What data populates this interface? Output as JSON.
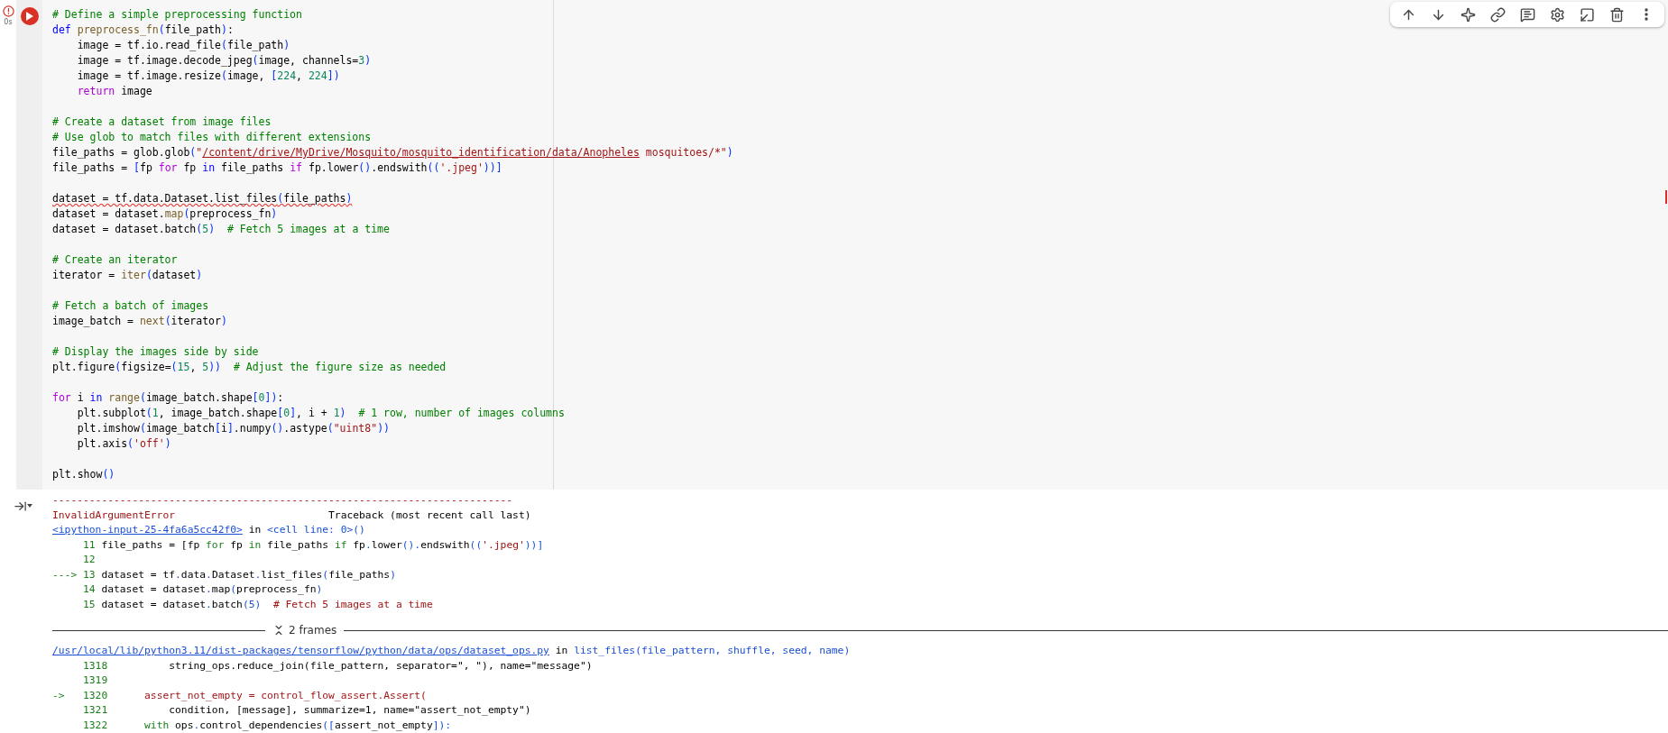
{
  "cell": {
    "error": true,
    "exec_time": "0s",
    "code_blocks": [
      {
        "lines": [
          [
            {
              "kind": "comment",
              "text": "# Define a simple preprocessing function"
            }
          ],
          [
            {
              "kind": "def",
              "text": "def"
            },
            {
              "kind": "func",
              "text": " preprocess_fn"
            },
            {
              "kind": "bracket",
              "text": "("
            },
            {
              "kind": "plain",
              "text": "file_path"
            },
            {
              "kind": "bracket",
              "text": ")"
            },
            {
              "kind": "plain",
              "text": ":"
            }
          ],
          [
            {
              "kind": "plain",
              "text": "    image = tf.io.read_file"
            },
            {
              "kind": "bracket",
              "text": "("
            },
            {
              "kind": "plain",
              "text": "file_path"
            },
            {
              "kind": "bracket",
              "text": ")"
            }
          ],
          [
            {
              "kind": "plain",
              "text": "    image = tf.image.decode_jpeg"
            },
            {
              "kind": "bracket",
              "text": "("
            },
            {
              "kind": "plain",
              "text": "image, channels="
            },
            {
              "kind": "num",
              "text": "3"
            },
            {
              "kind": "bracket",
              "text": ")"
            }
          ],
          [
            {
              "kind": "plain",
              "text": "    image = tf.image.resize"
            },
            {
              "kind": "bracket",
              "text": "("
            },
            {
              "kind": "plain",
              "text": "image, "
            },
            {
              "kind": "bracket",
              "text": "["
            },
            {
              "kind": "num",
              "text": "224"
            },
            {
              "kind": "plain",
              "text": ", "
            },
            {
              "kind": "num",
              "text": "224"
            },
            {
              "kind": "bracket",
              "text": "])"
            }
          ],
          [
            {
              "kind": "control",
              "text": "    return"
            },
            {
              "kind": "plain",
              "text": " image"
            }
          ]
        ]
      },
      {
        "lines": [
          [
            {
              "kind": "comment",
              "text": "# Create a dataset from image files"
            }
          ],
          [
            {
              "kind": "comment",
              "text": "# Use glob to match files with different extensions"
            }
          ],
          [
            {
              "kind": "plain",
              "text": "file_paths = glob.glob"
            },
            {
              "kind": "bracket",
              "text": "("
            },
            {
              "kind": "str",
              "text": "\""
            },
            {
              "kind": "str",
              "text": "/content/drive/MyDrive/Mosquito/mosquito_identification/data/Anopheles",
              "underline": true
            },
            {
              "kind": "str",
              "text": " mosquitoes/*\""
            },
            {
              "kind": "bracket",
              "text": ")"
            }
          ],
          [
            {
              "kind": "plain",
              "text": "file_paths = "
            },
            {
              "kind": "bracket",
              "text": "["
            },
            {
              "kind": "plain",
              "text": "fp "
            },
            {
              "kind": "control",
              "text": "for"
            },
            {
              "kind": "plain",
              "text": " fp "
            },
            {
              "kind": "def",
              "text": "in"
            },
            {
              "kind": "plain",
              "text": " file_paths "
            },
            {
              "kind": "control",
              "text": "if"
            },
            {
              "kind": "plain",
              "text": " fp.lower"
            },
            {
              "kind": "bracket",
              "text": "()"
            },
            {
              "kind": "plain",
              "text": ".endswith"
            },
            {
              "kind": "bracket",
              "text": "(("
            },
            {
              "kind": "str",
              "text": "'.jpeg'"
            },
            {
              "kind": "bracket",
              "text": "))]"
            }
          ]
        ]
      },
      {
        "lines": [
          [
            {
              "kind": "plain",
              "text": "dataset = tf.data.Dataset.list_files",
              "squiggle": true
            },
            {
              "kind": "bracket",
              "text": "(",
              "squiggle": true
            },
            {
              "kind": "plain",
              "text": "file_paths",
              "squiggle": true
            },
            {
              "kind": "bracket",
              "text": ")",
              "squiggle": true
            }
          ],
          [
            {
              "kind": "plain",
              "text": "dataset = dataset."
            },
            {
              "kind": "func",
              "text": "map"
            },
            {
              "kind": "bracket",
              "text": "("
            },
            {
              "kind": "plain",
              "text": "preprocess_fn"
            },
            {
              "kind": "bracket",
              "text": ")"
            }
          ],
          [
            {
              "kind": "plain",
              "text": "dataset = dataset.batch"
            },
            {
              "kind": "bracket",
              "text": "("
            },
            {
              "kind": "num",
              "text": "5"
            },
            {
              "kind": "bracket",
              "text": ")"
            },
            {
              "kind": "comment",
              "text": "  # Fetch 5 images at a time"
            }
          ]
        ]
      },
      {
        "lines": [
          [
            {
              "kind": "comment",
              "text": "# Create an iterator"
            }
          ],
          [
            {
              "kind": "plain",
              "text": "iterator = "
            },
            {
              "kind": "func",
              "text": "iter"
            },
            {
              "kind": "bracket",
              "text": "("
            },
            {
              "kind": "plain",
              "text": "dataset"
            },
            {
              "kind": "bracket",
              "text": ")"
            }
          ]
        ]
      },
      {
        "lines": [
          [
            {
              "kind": "comment",
              "text": "# Fetch a batch of images"
            }
          ],
          [
            {
              "kind": "plain",
              "text": "image_batch = "
            },
            {
              "kind": "func",
              "text": "next"
            },
            {
              "kind": "bracket",
              "text": "("
            },
            {
              "kind": "plain",
              "text": "iterator"
            },
            {
              "kind": "bracket",
              "text": ")"
            }
          ]
        ]
      },
      {
        "lines": [
          [
            {
              "kind": "comment",
              "text": "# Display the images side by side"
            }
          ],
          [
            {
              "kind": "plain",
              "text": "plt.figure"
            },
            {
              "kind": "bracket",
              "text": "("
            },
            {
              "kind": "plain",
              "text": "figsize="
            },
            {
              "kind": "bracket",
              "text": "("
            },
            {
              "kind": "num",
              "text": "15"
            },
            {
              "kind": "plain",
              "text": ", "
            },
            {
              "kind": "num",
              "text": "5"
            },
            {
              "kind": "bracket",
              "text": "))"
            },
            {
              "kind": "comment",
              "text": "  # Adjust the figure size as needed"
            }
          ]
        ]
      },
      {
        "lines": [
          [
            {
              "kind": "control",
              "text": "for"
            },
            {
              "kind": "plain",
              "text": " i "
            },
            {
              "kind": "def",
              "text": "in"
            },
            {
              "kind": "func",
              "text": " range"
            },
            {
              "kind": "bracket",
              "text": "("
            },
            {
              "kind": "plain",
              "text": "image_batch.shape"
            },
            {
              "kind": "bracket",
              "text": "["
            },
            {
              "kind": "num",
              "text": "0"
            },
            {
              "kind": "bracket",
              "text": "])"
            },
            {
              "kind": "plain",
              "text": ":"
            }
          ],
          [
            {
              "kind": "plain",
              "text": "    plt.subplot"
            },
            {
              "kind": "bracket",
              "text": "("
            },
            {
              "kind": "num",
              "text": "1"
            },
            {
              "kind": "plain",
              "text": ", image_batch.shape"
            },
            {
              "kind": "bracket",
              "text": "["
            },
            {
              "kind": "num",
              "text": "0"
            },
            {
              "kind": "bracket",
              "text": "]"
            },
            {
              "kind": "plain",
              "text": ", i + "
            },
            {
              "kind": "num",
              "text": "1"
            },
            {
              "kind": "bracket",
              "text": ")"
            },
            {
              "kind": "comment",
              "text": "  # 1 row, number of images columns"
            }
          ],
          [
            {
              "kind": "plain",
              "text": "    plt.imshow"
            },
            {
              "kind": "bracket",
              "text": "("
            },
            {
              "kind": "plain",
              "text": "image_batch"
            },
            {
              "kind": "bracket",
              "text": "["
            },
            {
              "kind": "plain",
              "text": "i"
            },
            {
              "kind": "bracket",
              "text": "]"
            },
            {
              "kind": "plain",
              "text": ".numpy"
            },
            {
              "kind": "bracket",
              "text": "()"
            },
            {
              "kind": "plain",
              "text": ".astype"
            },
            {
              "kind": "bracket",
              "text": "("
            },
            {
              "kind": "str",
              "text": "\"uint8\""
            },
            {
              "kind": "bracket",
              "text": "))"
            }
          ],
          [
            {
              "kind": "plain",
              "text": "    plt.axis"
            },
            {
              "kind": "bracket",
              "text": "("
            },
            {
              "kind": "str",
              "text": "'off'"
            },
            {
              "kind": "bracket",
              "text": ")"
            }
          ]
        ]
      },
      {
        "lines": [
          [
            {
              "kind": "plain",
              "text": "plt.show"
            },
            {
              "kind": "bracket",
              "text": "()"
            }
          ]
        ]
      }
    ]
  },
  "output": {
    "lines": [
      [
        {
          "kind": "error",
          "text": "---------------------------------------------------------------------------"
        }
      ],
      [
        {
          "kind": "error",
          "text": "InvalidArgumentError"
        },
        {
          "kind": "plain",
          "text": "                         Traceback (most recent call last)"
        }
      ],
      [
        {
          "kind": "link",
          "text": "<ipython-input-25-4fa6a5cc42f0>"
        },
        {
          "kind": "plain",
          "text": " in "
        },
        {
          "kind": "blue",
          "text": "<cell line: 0>()"
        }
      ],
      [
        {
          "kind": "lineno",
          "text": "     11"
        },
        {
          "kind": "plain",
          "text": " file_paths = [fp "
        },
        {
          "kind": "lineno",
          "text": "for"
        },
        {
          "kind": "plain",
          "text": " fp "
        },
        {
          "kind": "lineno",
          "text": "in"
        },
        {
          "kind": "plain",
          "text": " file_paths "
        },
        {
          "kind": "lineno",
          "text": "if"
        },
        {
          "kind": "plain",
          "text": " fp"
        },
        {
          "kind": "blue",
          "text": "."
        },
        {
          "kind": "plain",
          "text": "lower"
        },
        {
          "kind": "blue",
          "text": "()."
        },
        {
          "kind": "plain",
          "text": "endswith"
        },
        {
          "kind": "blue",
          "text": "(("
        },
        {
          "kind": "error",
          "text": "'.jpeg'"
        },
        {
          "kind": "blue",
          "text": "))]"
        }
      ],
      [
        {
          "kind": "lineno",
          "text": "     12"
        }
      ],
      [
        {
          "kind": "lineno",
          "text": "---> 13"
        },
        {
          "kind": "plain",
          "text": " dataset = tf"
        },
        {
          "kind": "blue",
          "text": "."
        },
        {
          "kind": "plain",
          "text": "data"
        },
        {
          "kind": "blue",
          "text": "."
        },
        {
          "kind": "plain",
          "text": "Dataset"
        },
        {
          "kind": "blue",
          "text": "."
        },
        {
          "kind": "plain",
          "text": "list_files"
        },
        {
          "kind": "blue",
          "text": "("
        },
        {
          "kind": "plain",
          "text": "file_paths"
        },
        {
          "kind": "blue",
          "text": ")"
        }
      ],
      [
        {
          "kind": "lineno",
          "text": "     14"
        },
        {
          "kind": "plain",
          "text": " dataset = dataset"
        },
        {
          "kind": "blue",
          "text": "."
        },
        {
          "kind": "plain",
          "text": "map"
        },
        {
          "kind": "blue",
          "text": "("
        },
        {
          "kind": "plain",
          "text": "preprocess_fn"
        },
        {
          "kind": "blue",
          "text": ")"
        }
      ],
      [
        {
          "kind": "lineno",
          "text": "     15"
        },
        {
          "kind": "plain",
          "text": " dataset = dataset"
        },
        {
          "kind": "blue",
          "text": "."
        },
        {
          "kind": "plain",
          "text": "batch"
        },
        {
          "kind": "blue",
          "text": "(5)"
        },
        {
          "kind": "error",
          "text": "  # Fetch 5 images at a time"
        }
      ]
    ],
    "frames_label": "2 frames",
    "frame_lines": [
      [
        {
          "kind": "link",
          "text": "/usr/local/lib/python3.11/dist-packages/tensorflow/python/data/ops/dataset_ops.py"
        },
        {
          "kind": "plain",
          "text": " in "
        },
        {
          "kind": "blue",
          "text": "list_files(file_pattern, shuffle, seed, name)"
        }
      ],
      [
        {
          "kind": "lineno",
          "text": "     1318"
        },
        {
          "kind": "plain",
          "text": "          string_ops.reduce_join(file_pattern, separator=\", \"), name=\"message\")"
        }
      ],
      [
        {
          "kind": "lineno",
          "text": "     1319"
        }
      ],
      [
        {
          "kind": "lineno",
          "text": "->   1320"
        },
        {
          "kind": "error",
          "text": "      assert_not_empty = control_flow_assert.Assert("
        }
      ],
      [
        {
          "kind": "lineno",
          "text": "     1321"
        },
        {
          "kind": "plain",
          "text": "          condition, [message], summarize=1, name=\"assert_not_empty\")"
        }
      ],
      [
        {
          "kind": "lineno",
          "text": "     1322"
        },
        {
          "kind": "lineno",
          "text": "      with"
        },
        {
          "kind": "plain",
          "text": " ops"
        },
        {
          "kind": "blue",
          "text": "."
        },
        {
          "kind": "plain",
          "text": "control_dependencies"
        },
        {
          "kind": "blue",
          "text": "(["
        },
        {
          "kind": "plain",
          "text": "assert_not_empty"
        },
        {
          "kind": "blue",
          "text": "]):"
        }
      ]
    ]
  }
}
